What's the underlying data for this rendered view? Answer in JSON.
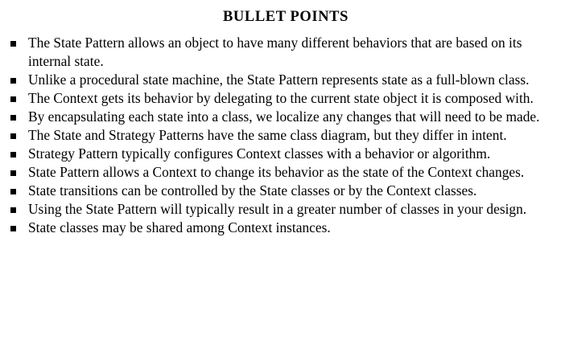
{
  "heading": "BULLET POINTS",
  "bullets": [
    "The State Pattern allows an object to have many different behaviors that are based on its internal state.",
    "Unlike a procedural state machine, the State Pattern represents state as a full-blown class.",
    "The Context gets its behavior by delegating to the current state object it is composed with.",
    "By encapsulating each state into a class, we localize any changes that will need to be made.",
    "The State and Strategy Patterns have the same class diagram, but they differ in intent.",
    "Strategy Pattern typically configures Context classes with a behavior or algorithm.",
    "State Pattern allows a Context to change its behavior as the state of the Context changes.",
    "State transitions can be controlled by the State classes or by the Context classes.",
    "Using the State Pattern will typically result in a greater number of classes in your design.",
    "State classes may be shared among Context instances."
  ]
}
